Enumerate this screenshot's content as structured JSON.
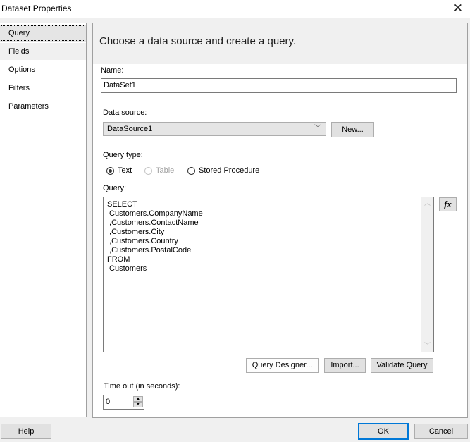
{
  "window": {
    "title": "Dataset Properties",
    "close_icon": "close-icon"
  },
  "sidebar": {
    "items": [
      {
        "label": "Query",
        "state": "selected"
      },
      {
        "label": "Fields",
        "state": "hover"
      },
      {
        "label": "Options",
        "state": "normal"
      },
      {
        "label": "Filters",
        "state": "normal"
      },
      {
        "label": "Parameters",
        "state": "normal"
      }
    ]
  },
  "main": {
    "header": "Choose a data source and create a query.",
    "name_label": "Name:",
    "name_value": "DataSet1",
    "datasource_label": "Data source:",
    "datasource_value": "DataSource1",
    "new_button": "New...",
    "query_type_label": "Query type:",
    "query_types": [
      {
        "label": "Text",
        "selected": true,
        "enabled": true
      },
      {
        "label": "Table",
        "selected": false,
        "enabled": false
      },
      {
        "label": "Stored Procedure",
        "selected": false,
        "enabled": true
      }
    ],
    "query_label": "Query:",
    "query_text": "SELECT\n Customers.CompanyName\n ,Customers.ContactName\n ,Customers.City\n ,Customers.Country\n ,Customers.PostalCode\nFROM\n Customers",
    "fx_button": "fx",
    "query_designer_button": "Query Designer...",
    "import_button": "Import...",
    "validate_button": "Validate Query",
    "timeout_label": "Time out (in seconds):",
    "timeout_value": "0"
  },
  "footer": {
    "help": "Help",
    "ok": "OK",
    "cancel": "Cancel"
  },
  "colors": {
    "accent": "#0078d7",
    "panel_bg": "#f0f0f0"
  }
}
